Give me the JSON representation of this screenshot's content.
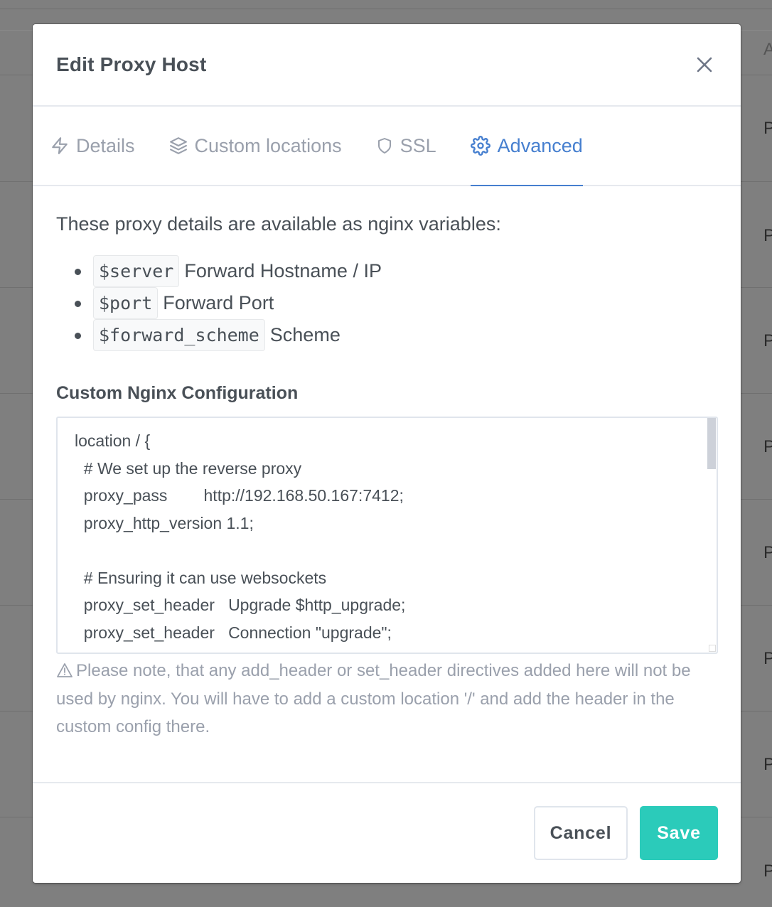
{
  "background": {
    "header_cell": "A",
    "row_cells": [
      "P",
      "P",
      "P",
      "P",
      "P",
      "P",
      "P",
      "P"
    ]
  },
  "modal": {
    "title": "Edit Proxy Host",
    "close_icon": "close-icon",
    "tabs": [
      {
        "label": "Details",
        "icon": "lightning-icon",
        "active": false
      },
      {
        "label": "Custom locations",
        "icon": "layers-icon",
        "active": false
      },
      {
        "label": "SSL",
        "icon": "shield-icon",
        "active": false
      },
      {
        "label": "Advanced",
        "icon": "gear-icon",
        "active": true
      }
    ],
    "intro": "These proxy details are available as nginx variables:",
    "variables": [
      {
        "code": "$server",
        "description": "Forward Hostname / IP"
      },
      {
        "code": "$port",
        "description": "Forward Port"
      },
      {
        "code": "$forward_scheme",
        "description": "Scheme"
      }
    ],
    "config_label": "Custom Nginx Configuration",
    "config_value": "location / {\n  # We set up the reverse proxy\n  proxy_pass        http://192.168.50.167:7412;\n  proxy_http_version 1.1;\n\n  # Ensuring it can use websockets\n  proxy_set_header   Upgrade $http_upgrade;\n  proxy_set_header   Connection \"upgrade\";\n  proxy_set_header   X-Real-IP $remote_addr;",
    "note": "Please note, that any add_header or set_header directives added here will not be used by nginx. You will have to add a custom location '/' and add the header in the custom config there.",
    "cancel_label": "Cancel",
    "save_label": "Save"
  },
  "colors": {
    "accent": "#467fcf",
    "save": "#2bcbba",
    "muted": "#9aa0ac",
    "text": "#495057",
    "overlay": "#7f7f7f"
  }
}
